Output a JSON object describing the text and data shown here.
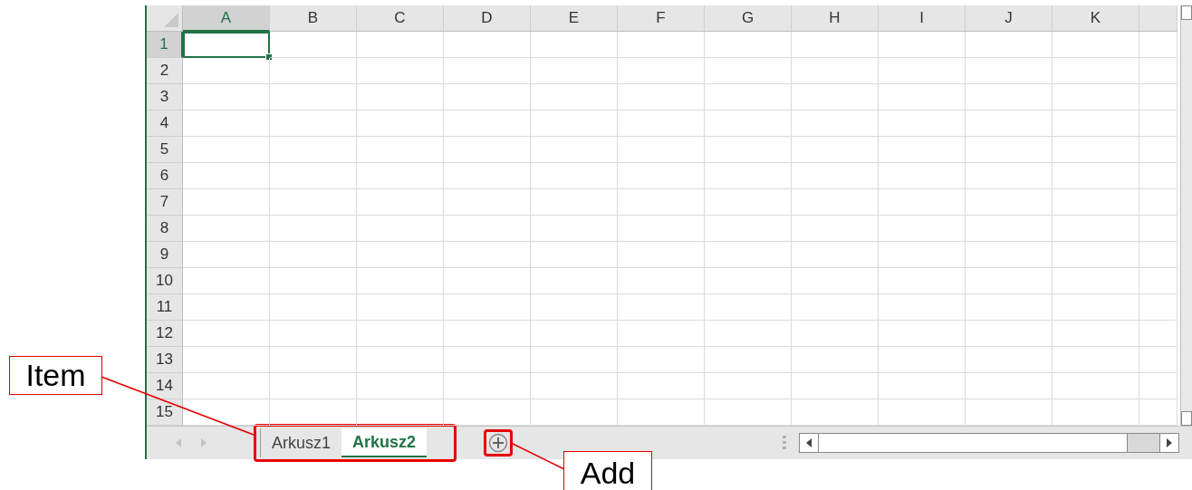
{
  "columns": [
    {
      "label": "A",
      "selected": true
    },
    {
      "label": "B",
      "selected": false
    },
    {
      "label": "C",
      "selected": false
    },
    {
      "label": "D",
      "selected": false
    },
    {
      "label": "E",
      "selected": false
    },
    {
      "label": "F",
      "selected": false
    },
    {
      "label": "G",
      "selected": false
    },
    {
      "label": "H",
      "selected": false
    },
    {
      "label": "I",
      "selected": false
    },
    {
      "label": "J",
      "selected": false
    },
    {
      "label": "K",
      "selected": false
    }
  ],
  "rows": [
    {
      "label": "1",
      "selected": true
    },
    {
      "label": "2",
      "selected": false
    },
    {
      "label": "3",
      "selected": false
    },
    {
      "label": "4",
      "selected": false
    },
    {
      "label": "5",
      "selected": false
    },
    {
      "label": "6",
      "selected": false
    },
    {
      "label": "7",
      "selected": false
    },
    {
      "label": "8",
      "selected": false
    },
    {
      "label": "9",
      "selected": false
    },
    {
      "label": "10",
      "selected": false
    },
    {
      "label": "11",
      "selected": false
    },
    {
      "label": "12",
      "selected": false
    },
    {
      "label": "13",
      "selected": false
    },
    {
      "label": "14",
      "selected": false
    },
    {
      "label": "15",
      "selected": false
    }
  ],
  "sheet_tabs": [
    {
      "label": "Arkusz1",
      "selected": false
    },
    {
      "label": "Arkusz2",
      "selected": true
    }
  ],
  "callouts": [
    {
      "text": "Item"
    },
    {
      "text": "Add"
    }
  ]
}
